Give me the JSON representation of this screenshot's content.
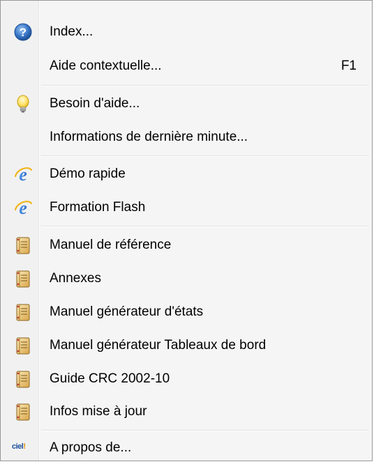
{
  "menu": {
    "items": [
      {
        "label": "Index...",
        "icon": "help-icon",
        "shortcut": ""
      },
      {
        "label": "Aide contextuelle...",
        "icon": "",
        "shortcut": "F1"
      },
      {
        "label": "Besoin d'aide...",
        "icon": "lightbulb-icon",
        "shortcut": ""
      },
      {
        "label": "Informations de dernière minute...",
        "icon": "",
        "shortcut": ""
      },
      {
        "label": "Démo rapide",
        "icon": "internet-explorer-icon",
        "shortcut": ""
      },
      {
        "label": "Formation Flash",
        "icon": "internet-explorer-icon",
        "shortcut": ""
      },
      {
        "label": "Manuel de référence",
        "icon": "manual-book-icon",
        "shortcut": ""
      },
      {
        "label": "Annexes",
        "icon": "manual-book-icon",
        "shortcut": ""
      },
      {
        "label": "Manuel générateur d'états",
        "icon": "manual-book-icon",
        "shortcut": ""
      },
      {
        "label": "Manuel générateur Tableaux de bord",
        "icon": "manual-book-icon",
        "shortcut": ""
      },
      {
        "label": "Guide CRC 2002-10",
        "icon": "manual-book-icon",
        "shortcut": ""
      },
      {
        "label": "Infos mise à jour",
        "icon": "manual-book-icon",
        "shortcut": ""
      },
      {
        "label": "A propos de...",
        "icon": "ciel-logo-icon",
        "shortcut": ""
      }
    ],
    "logo_text": "ciel",
    "logo_mark": "!",
    "colors": {
      "help_blue": "#3a78c9",
      "bulb_yellow": "#ffe36a",
      "ie_blue": "#1e6fd1",
      "book_tan": "#e8c98a"
    }
  }
}
